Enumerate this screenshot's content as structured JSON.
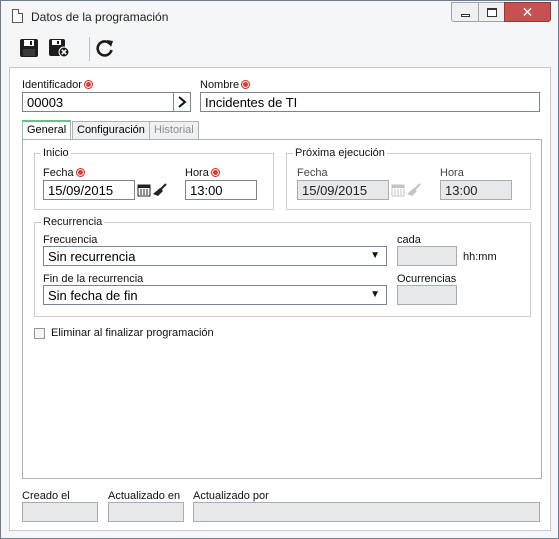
{
  "window": {
    "title": "Datos de la programación",
    "close_label": "✕"
  },
  "toolbar": {
    "save_icon": "save-icon",
    "save_close_icon": "save-close-icon",
    "refresh_icon": "refresh-icon"
  },
  "header": {
    "identifier_label": "Identificador",
    "identifier_value": "00003",
    "name_label": "Nombre",
    "name_value": "Incidentes de TI"
  },
  "tabs": [
    {
      "label": "General",
      "state": "active"
    },
    {
      "label": "Configuración",
      "state": "normal"
    },
    {
      "label": "Historial",
      "state": "disabled"
    }
  ],
  "inicio": {
    "title": "Inicio",
    "date_label": "Fecha",
    "date_value": "15/09/2015",
    "time_label": "Hora",
    "time_value": "13:00"
  },
  "proxima": {
    "title": "Próxima ejecución",
    "date_label": "Fecha",
    "date_value": "15/09/2015",
    "time_label": "Hora",
    "time_value": "13:00"
  },
  "recurrencia": {
    "title": "Recurrencia",
    "frequency_label": "Frecuencia",
    "frequency_value": "Sin recurrencia",
    "every_label": "cada",
    "every_value": "",
    "every_unit": "hh:mm",
    "end_label": "Fin de la recurrencia",
    "end_value": "Sin fecha de fin",
    "occurrences_label": "Ocurrencias",
    "occurrences_value": ""
  },
  "options": {
    "delete_on_finish_label": "Eliminar al finalizar programación",
    "delete_on_finish_checked": false
  },
  "footer": {
    "created_label": "Creado el",
    "created_value": "",
    "updated_on_label": "Actualizado en",
    "updated_on_value": "",
    "updated_by_label": "Actualizado por",
    "updated_by_value": ""
  },
  "colors": {
    "required": "#e33333",
    "active_tab_accent": "#6cbf82",
    "close_button": "#c75050"
  }
}
